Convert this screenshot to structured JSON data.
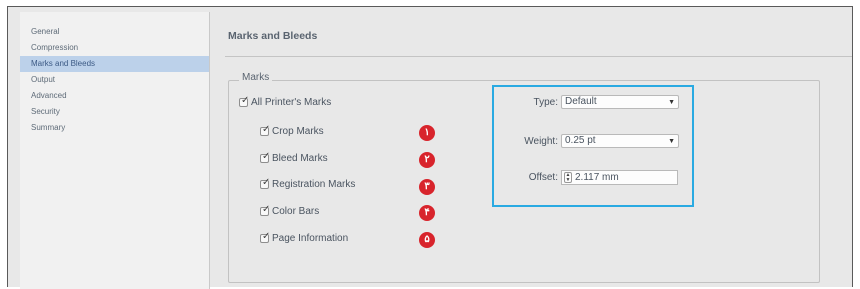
{
  "sidebar": {
    "items": [
      {
        "label": "General"
      },
      {
        "label": "Compression"
      },
      {
        "label": "Marks and Bleeds"
      },
      {
        "label": "Output"
      },
      {
        "label": "Advanced"
      },
      {
        "label": "Security"
      },
      {
        "label": "Summary"
      }
    ],
    "selected_index": 2
  },
  "main": {
    "title": "Marks and Bleeds",
    "group_label": "Marks",
    "all_printers_marks": {
      "label": "All Printer's Marks",
      "checked": true
    },
    "marks": [
      {
        "label": "Crop Marks",
        "checked": true,
        "badge": "۱"
      },
      {
        "label": "Bleed Marks",
        "checked": true,
        "badge": "۲"
      },
      {
        "label": "Registration Marks",
        "checked": true,
        "badge": "۳"
      },
      {
        "label": "Color Bars",
        "checked": true,
        "badge": "۴"
      },
      {
        "label": "Page Information",
        "checked": true,
        "badge": "۵"
      }
    ],
    "type": {
      "label": "Type:",
      "value": "Default"
    },
    "weight": {
      "label": "Weight:",
      "value": "0.25 pt"
    },
    "offset": {
      "label": "Offset:",
      "value": "2.117 mm"
    },
    "highlight_color": "#2aaae2",
    "badge_color": "#d8242c"
  }
}
